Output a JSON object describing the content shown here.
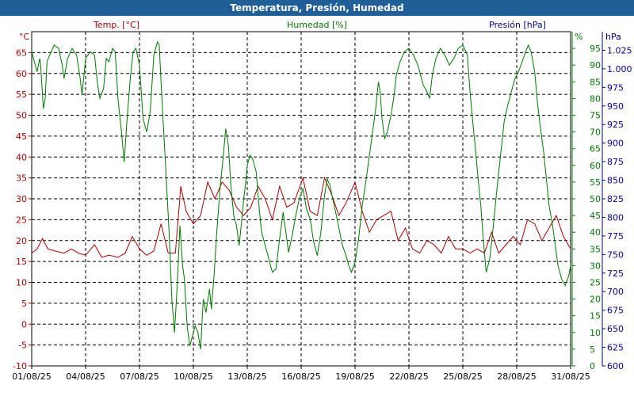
{
  "chart_data": {
    "type": "line",
    "title": "Temperatura, Presión, Humedad",
    "x_tick_labels": [
      "01/08/25",
      "04/08/25",
      "07/08/25",
      "10/08/25",
      "13/08/25",
      "16/08/25",
      "19/08/25",
      "22/08/25",
      "25/08/25",
      "28/08/25",
      "31/08/25"
    ],
    "x_range_days": [
      0,
      30
    ],
    "axes": {
      "temperature": {
        "unit": "°C",
        "header": "Temp. [°C]",
        "range": [
          -10,
          70
        ],
        "ticks": [
          "65",
          "60",
          "55",
          "50",
          "45",
          "40",
          "35",
          "30",
          "25",
          "20",
          "15",
          "10",
          "5",
          "0",
          "-5",
          "-10"
        ],
        "color": "#aa0000"
      },
      "humidity": {
        "unit": "%",
        "header": "Humedad [%]",
        "range": [
          0,
          100
        ],
        "ticks": [
          "95",
          "90",
          "85",
          "80",
          "75",
          "70",
          "65",
          "60",
          "55",
          "50",
          "45",
          "40",
          "35",
          "30",
          "25",
          "20",
          "15",
          "10",
          "5",
          "0"
        ],
        "color": "#007700"
      },
      "pressure": {
        "unit": "hPa",
        "header": "Presión [hPa]",
        "range": [
          600,
          1050
        ],
        "ticks": [
          "1.025",
          "1.000",
          "975",
          "950",
          "925",
          "900",
          "875",
          "850",
          "825",
          "800",
          "775",
          "750",
          "725",
          "700",
          "675",
          "650",
          "625",
          "600"
        ],
        "color": "#000099"
      }
    },
    "grid": true,
    "series": [
      {
        "name": "Temp. [°C]",
        "color": "#aa0000",
        "points": [
          [
            0,
            17
          ],
          [
            0.3,
            18
          ],
          [
            0.6,
            20.5
          ],
          [
            0.9,
            18
          ],
          [
            1.3,
            17.5
          ],
          [
            1.8,
            17
          ],
          [
            2.2,
            18
          ],
          [
            2.6,
            17
          ],
          [
            3,
            16.5
          ],
          [
            3.5,
            19
          ],
          [
            3.9,
            16
          ],
          [
            4.3,
            16.5
          ],
          [
            4.8,
            16
          ],
          [
            5.2,
            17
          ],
          [
            5.6,
            21
          ],
          [
            6,
            18
          ],
          [
            6.4,
            16.5
          ],
          [
            6.8,
            17.5
          ],
          [
            7.2,
            24
          ],
          [
            7.6,
            17
          ],
          [
            8,
            17
          ],
          [
            8.3,
            33
          ],
          [
            8.6,
            27
          ],
          [
            9,
            24
          ],
          [
            9.4,
            26
          ],
          [
            9.8,
            34
          ],
          [
            10.2,
            30
          ],
          [
            10.6,
            34
          ],
          [
            11,
            32
          ],
          [
            11.4,
            28
          ],
          [
            11.8,
            26
          ],
          [
            12.2,
            28
          ],
          [
            12.6,
            33
          ],
          [
            13,
            30
          ],
          [
            13.4,
            25
          ],
          [
            13.8,
            33
          ],
          [
            14.2,
            28
          ],
          [
            14.6,
            29
          ],
          [
            15.1,
            35
          ],
          [
            15.5,
            27
          ],
          [
            15.9,
            26
          ],
          [
            16.3,
            35
          ],
          [
            16.7,
            31
          ],
          [
            17.1,
            26
          ],
          [
            17.5,
            29
          ],
          [
            18,
            34
          ],
          [
            18.4,
            27
          ],
          [
            18.8,
            22
          ],
          [
            19.2,
            25
          ],
          [
            19.6,
            26
          ],
          [
            20,
            27
          ],
          [
            20.4,
            20
          ],
          [
            20.8,
            23
          ],
          [
            21.2,
            18
          ],
          [
            21.6,
            17
          ],
          [
            22,
            20
          ],
          [
            22.4,
            19
          ],
          [
            22.8,
            17
          ],
          [
            23.2,
            21
          ],
          [
            23.6,
            18
          ],
          [
            24,
            18
          ],
          [
            24.4,
            17
          ],
          [
            24.8,
            18
          ],
          [
            25.2,
            17
          ],
          [
            25.6,
            22
          ],
          [
            26,
            17
          ],
          [
            26.4,
            19
          ],
          [
            26.8,
            21
          ],
          [
            27.2,
            19
          ],
          [
            27.6,
            25
          ],
          [
            28,
            24
          ],
          [
            28.4,
            20
          ],
          [
            28.8,
            23
          ],
          [
            29.2,
            26
          ],
          [
            29.6,
            21
          ],
          [
            30,
            18
          ]
        ]
      },
      {
        "name": "Humedad [%]",
        "color": "#007700",
        "points": [
          [
            0,
            94
          ],
          [
            0.3,
            91
          ],
          [
            0.6,
            88
          ],
          [
            0.9,
            92
          ],
          [
            1,
            90
          ],
          [
            1.3,
            77
          ],
          [
            1.5,
            80
          ],
          [
            1.7,
            91
          ],
          [
            2,
            93
          ],
          [
            2.5,
            96
          ],
          [
            3,
            95
          ],
          [
            3.4,
            90
          ],
          [
            3.6,
            86
          ],
          [
            4,
            92
          ],
          [
            4.5,
            95
          ],
          [
            5,
            93
          ],
          [
            5.4,
            86
          ],
          [
            5.6,
            81
          ],
          [
            6,
            92
          ],
          [
            6.5,
            94
          ],
          [
            7,
            93
          ],
          [
            7.3,
            85
          ],
          [
            7.6,
            80
          ],
          [
            8,
            83
          ],
          [
            8.3,
            92
          ],
          [
            8.6,
            91
          ],
          [
            9,
            95
          ],
          [
            9.3,
            94
          ],
          [
            9.6,
            80
          ],
          [
            10,
            70
          ],
          [
            10.3,
            61
          ],
          [
            10.6,
            73
          ],
          [
            11,
            87
          ],
          [
            11.3,
            94
          ],
          [
            11.6,
            95
          ],
          [
            12,
            90
          ],
          [
            12.4,
            74
          ],
          [
            12.8,
            70
          ],
          [
            13.2,
            76
          ],
          [
            13.6,
            93
          ],
          [
            14,
            97
          ],
          [
            14.2,
            96
          ],
          [
            14.4,
            85
          ],
          [
            14.7,
            70
          ],
          [
            15,
            55
          ],
          [
            15.3,
            40
          ],
          [
            15.6,
            20
          ],
          [
            15.9,
            10
          ],
          [
            16.2,
            24
          ],
          [
            16.5,
            42
          ],
          [
            16.8,
            30
          ],
          [
            17,
            26
          ],
          [
            17.3,
            12
          ],
          [
            17.6,
            6
          ],
          [
            17.9,
            9
          ],
          [
            18.2,
            12
          ],
          [
            18.5,
            10
          ],
          [
            18.8,
            5
          ],
          [
            19.1,
            20
          ],
          [
            19.4,
            16
          ],
          [
            19.8,
            23
          ],
          [
            20,
            17
          ],
          [
            20.3,
            27
          ],
          [
            20.6,
            40
          ],
          [
            21,
            54
          ],
          [
            21.3,
            62
          ],
          [
            21.6,
            71
          ],
          [
            21.9,
            66
          ],
          [
            22.2,
            53
          ],
          [
            22.5,
            45
          ],
          [
            22.8,
            42
          ],
          [
            23.1,
            36
          ],
          [
            23.4,
            44
          ],
          [
            23.6,
            50
          ],
          [
            23.8,
            54
          ],
          [
            24,
            60
          ],
          [
            24.3,
            63
          ],
          [
            24.6,
            62
          ],
          [
            25,
            58
          ],
          [
            25.3,
            48
          ],
          [
            25.6,
            40
          ],
          [
            26,
            36
          ],
          [
            26.4,
            32
          ],
          [
            26.8,
            28
          ],
          [
            27.2,
            29
          ],
          [
            27.6,
            38
          ],
          [
            28,
            46
          ],
          [
            28.3,
            40
          ],
          [
            28.6,
            34
          ],
          [
            29,
            39
          ],
          [
            29.4,
            45
          ],
          [
            29.8,
            50
          ],
          [
            30.2,
            53
          ],
          [
            30.6,
            47
          ],
          [
            31,
            44
          ],
          [
            31.4,
            37
          ],
          [
            31.8,
            33
          ],
          [
            32.2,
            40
          ],
          [
            32.6,
            51
          ],
          [
            32.9,
            56
          ],
          [
            33.2,
            54
          ],
          [
            33.6,
            49
          ],
          [
            34,
            44
          ],
          [
            34.3,
            40
          ],
          [
            34.6,
            36
          ],
          [
            35,
            33
          ],
          [
            35.3,
            30
          ],
          [
            35.6,
            28
          ],
          [
            36,
            31
          ],
          [
            36.4,
            38
          ],
          [
            36.8,
            48
          ],
          [
            37.2,
            55
          ],
          [
            37.6,
            63
          ],
          [
            38,
            71
          ],
          [
            38.3,
            77
          ],
          [
            38.6,
            85
          ],
          [
            38.8,
            82
          ],
          [
            39,
            74
          ],
          [
            39.3,
            68
          ],
          [
            39.6,
            70
          ],
          [
            40,
            75
          ],
          [
            40.3,
            80
          ],
          [
            40.6,
            87
          ],
          [
            41,
            91
          ],
          [
            41.5,
            94
          ],
          [
            42,
            95
          ],
          [
            42.5,
            93
          ],
          [
            43,
            90
          ],
          [
            43.3,
            87
          ],
          [
            43.6,
            84
          ],
          [
            44,
            82
          ],
          [
            44.3,
            80
          ],
          [
            44.6,
            87
          ],
          [
            45,
            92
          ],
          [
            45.5,
            95
          ],
          [
            46,
            93
          ],
          [
            46.5,
            90
          ],
          [
            47,
            92
          ],
          [
            47.5,
            95
          ],
          [
            48,
            96
          ],
          [
            48.5,
            93
          ],
          [
            48.8,
            82
          ],
          [
            49.1,
            73
          ],
          [
            49.4,
            65
          ],
          [
            49.7,
            56
          ],
          [
            50,
            48
          ],
          [
            50.3,
            37
          ],
          [
            50.6,
            28
          ],
          [
            51,
            32
          ],
          [
            51.4,
            42
          ],
          [
            51.8,
            53
          ],
          [
            52.2,
            63
          ],
          [
            52.6,
            73
          ],
          [
            53,
            78
          ],
          [
            53.4,
            82
          ],
          [
            53.8,
            86
          ],
          [
            54.2,
            88
          ],
          [
            54.6,
            91
          ],
          [
            55,
            94
          ],
          [
            55.3,
            96
          ],
          [
            55.6,
            94
          ],
          [
            56,
            88
          ],
          [
            56.3,
            79
          ],
          [
            56.6,
            72
          ],
          [
            57,
            64
          ],
          [
            57.3,
            56
          ],
          [
            57.6,
            48
          ],
          [
            58,
            42
          ],
          [
            58.3,
            36
          ],
          [
            58.6,
            30
          ],
          [
            59,
            26
          ],
          [
            59.4,
            24
          ],
          [
            59.8,
            27
          ],
          [
            60,
            30
          ]
        ]
      }
    ]
  }
}
